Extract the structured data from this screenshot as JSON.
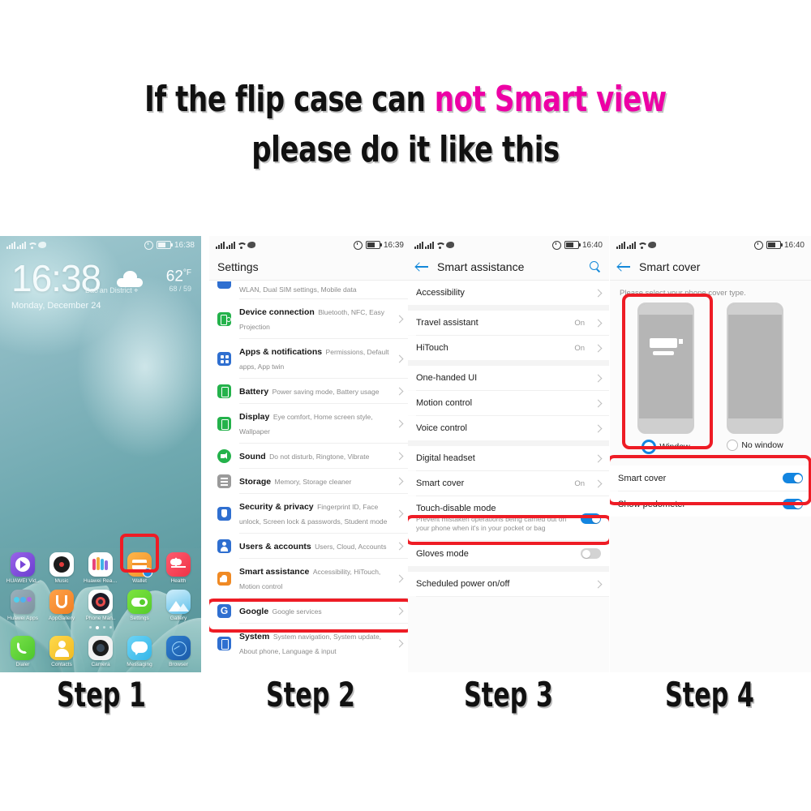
{
  "headline": {
    "line1_black": "If the flip case can ",
    "line1_pink": "not Smart view",
    "line2": "please do it like this",
    "pink_color": "#ED00A5"
  },
  "accent": {
    "highlight_red": "#EE1C25",
    "toggle_blue": "#1385E0",
    "link_blue": "#1288D9"
  },
  "step1": {
    "status": {
      "time": "16:38"
    },
    "clock": "16:38",
    "location": "Bao'an District",
    "date": "Monday, December 24",
    "weather": {
      "temp": "62",
      "unit": "°F",
      "high_low": "68 / 59"
    },
    "apps_row1": [
      {
        "label": "HUAWEI Vid..",
        "icon": "huawei-video-icon"
      },
      {
        "label": "Music",
        "icon": "music-icon"
      },
      {
        "label": "Huawei Read..",
        "icon": "huawei-reader-icon"
      },
      {
        "label": "Wallet",
        "icon": "wallet-icon"
      },
      {
        "label": "Health",
        "icon": "health-icon"
      }
    ],
    "apps_row2": [
      {
        "label": "Huawei Apps",
        "icon": "huawei-apps-icon"
      },
      {
        "label": "AppGallery",
        "icon": "appgallery-icon"
      },
      {
        "label": "Phone Man..",
        "icon": "phone-manager-icon"
      },
      {
        "label": "Settings",
        "icon": "settings-icon"
      },
      {
        "label": "Gallery",
        "icon": "gallery-icon"
      }
    ],
    "apps_row3": [
      {
        "label": "Dialer",
        "icon": "dialer-icon"
      },
      {
        "label": "Contacts",
        "icon": "contacts-icon"
      },
      {
        "label": "Camera",
        "icon": "camera-icon"
      },
      {
        "label": "Messaging",
        "icon": "messaging-icon"
      },
      {
        "label": "Browser",
        "icon": "browser-icon"
      }
    ],
    "highlighted_app": "Settings"
  },
  "step2": {
    "status": {
      "time": "16:39"
    },
    "title": "Settings",
    "partial_row_subtitle": "WLAN, Dual SIM settings, Mobile data",
    "rows": [
      {
        "title": "Device connection",
        "subtitle": "Bluetooth, NFC, Easy Projection",
        "icon_color": "#24B24B"
      },
      {
        "title": "Apps & notifications",
        "subtitle": "Permissions, Default apps, App twin",
        "icon_color": "#2F6FD0"
      },
      {
        "title": "Battery",
        "subtitle": "Power saving mode, Battery usage",
        "icon_color": "#24B24B"
      },
      {
        "title": "Display",
        "subtitle": "Eye comfort, Home screen style, Wallpaper",
        "icon_color": "#24B24B"
      },
      {
        "title": "Sound",
        "subtitle": "Do not disturb, Ringtone, Vibrate",
        "icon_color": "#24B24B"
      },
      {
        "title": "Storage",
        "subtitle": "Memory, Storage cleaner",
        "icon_color": "#9A9A9A"
      },
      {
        "title": "Security & privacy",
        "subtitle": "Fingerprint ID, Face unlock, Screen lock & passwords, Student mode",
        "icon_color": "#2F6FD0"
      },
      {
        "title": "Users & accounts",
        "subtitle": "Users, Cloud, Accounts",
        "icon_color": "#2F6FD0"
      },
      {
        "title": "Smart assistance",
        "subtitle": "Accessibility, HiTouch, Motion control",
        "icon_color": "#F08A24"
      },
      {
        "title": "Google",
        "subtitle": "Google services",
        "icon_color": "#2F6FD0"
      },
      {
        "title": "System",
        "subtitle": "System navigation, System update, About phone, Language & input",
        "icon_color": "#2F6FD0"
      }
    ],
    "highlighted_row": "Smart assistance"
  },
  "step3": {
    "status": {
      "time": "16:40"
    },
    "title": "Smart assistance",
    "rows": [
      {
        "label": "Accessibility",
        "value": "",
        "type": "chevron"
      },
      {
        "label": "Travel assistant",
        "value": "On",
        "type": "chevron"
      },
      {
        "label": "HiTouch",
        "value": "On",
        "type": "chevron"
      },
      {
        "label": "One-handed UI",
        "value": "",
        "type": "chevron"
      },
      {
        "label": "Motion control",
        "value": "",
        "type": "chevron"
      },
      {
        "label": "Voice control",
        "value": "",
        "type": "chevron"
      },
      {
        "label": "Digital headset",
        "value": "",
        "type": "chevron"
      },
      {
        "label": "Smart cover",
        "value": "On",
        "type": "chevron"
      },
      {
        "label": "Touch-disable mode",
        "subtitle": "Prevent mistaken operations being carried out on your phone when it's in your pocket or bag",
        "type": "toggle",
        "toggle": "on"
      },
      {
        "label": "Gloves mode",
        "type": "toggle",
        "toggle": "off"
      },
      {
        "label": "Scheduled power on/off",
        "value": "",
        "type": "chevron"
      }
    ],
    "highlighted_row": "Smart cover"
  },
  "step4": {
    "status": {
      "time": "16:40"
    },
    "title": "Smart cover",
    "hint": "Please select your phone cover type.",
    "options": [
      {
        "label": "Window",
        "selected": true
      },
      {
        "label": "No window",
        "selected": false
      }
    ],
    "toggles": [
      {
        "label": "Smart cover",
        "state": "on"
      },
      {
        "label": "Show pedometer",
        "state": "on"
      }
    ],
    "highlighted": [
      "Window",
      "Smart cover",
      "Show pedometer"
    ]
  },
  "steps_labels": [
    "Step 1",
    "Step 2",
    "Step 3",
    "Step 4"
  ]
}
